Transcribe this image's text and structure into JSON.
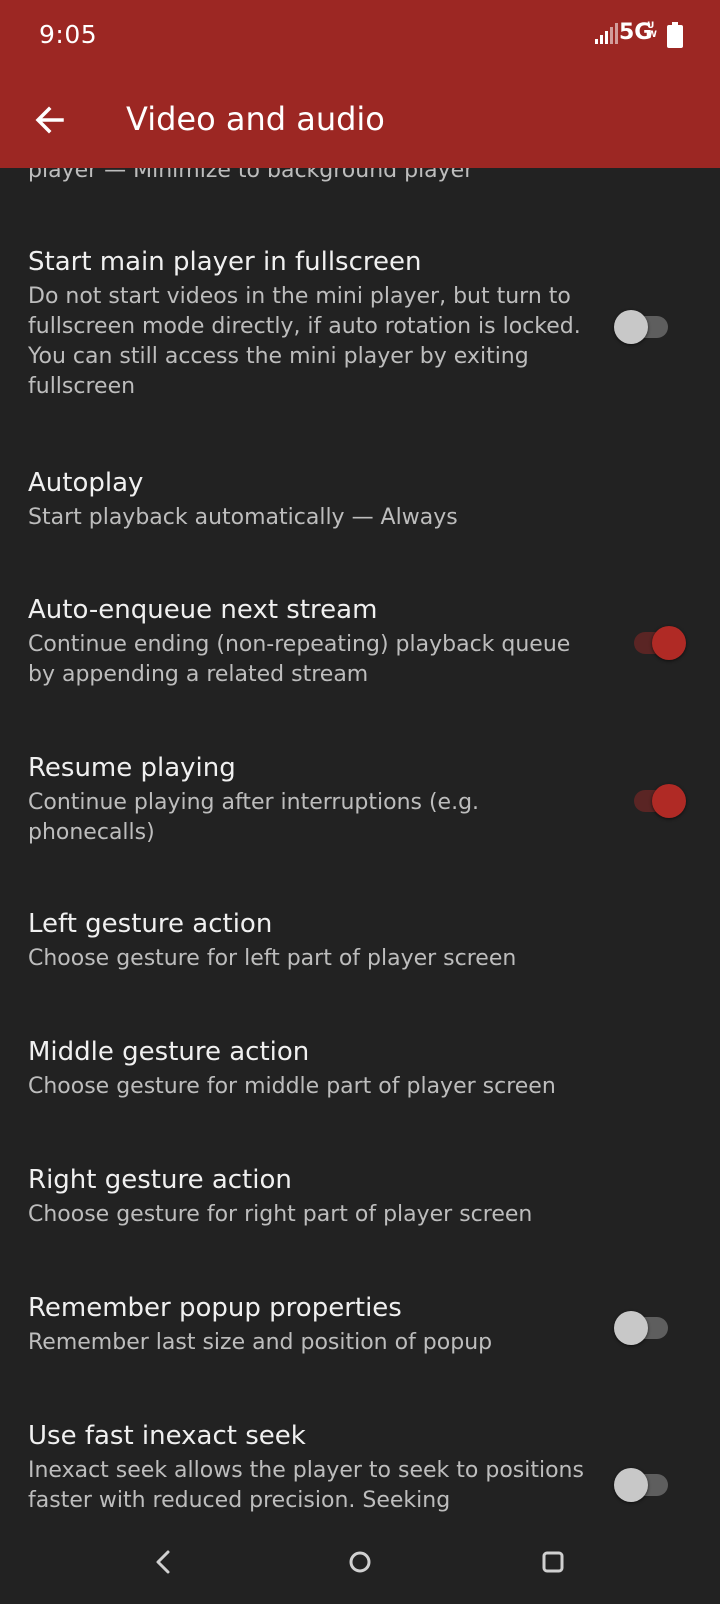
{
  "status_bar": {
    "time": "9:05",
    "network": "5G",
    "network_sub_top": "U",
    "network_sub_bottom": "W",
    "icons": [
      "signal-icon",
      "battery-icon"
    ]
  },
  "app_bar": {
    "title": "Video and audio",
    "back_icon": "arrow-left-icon"
  },
  "partial_summary": "player — Minimize to background player",
  "preferences": [
    {
      "title": "Start main player in fullscreen",
      "summary": "Do not start videos in the mini player, but turn to fullscreen mode directly, if auto rotation is locked. You can still access the mini player by exiting fullscreen",
      "switch": "off"
    },
    {
      "title": "Autoplay",
      "summary": "Start playback automatically — Always",
      "switch": "none"
    },
    {
      "title": "Auto-enqueue next stream",
      "summary": "Continue ending (non-repeating) playback queue by appending a related stream",
      "switch": "on"
    },
    {
      "title": "Resume playing",
      "summary": "Continue playing after interruptions (e.g. phonecalls)",
      "switch": "on"
    },
    {
      "title": "Left gesture action",
      "summary": "Choose gesture for left part of player screen",
      "switch": "none"
    },
    {
      "title": "Middle gesture action",
      "summary": "Choose gesture for middle part of player screen",
      "switch": "none"
    },
    {
      "title": "Right gesture action",
      "summary": "Choose gesture for right part of player screen",
      "switch": "none"
    },
    {
      "title": "Remember popup properties",
      "summary": "Remember last size and position of popup",
      "switch": "off"
    },
    {
      "title": "Use fast inexact seek",
      "summary": "Inexact seek allows the player to seek to positions faster with reduced precision. Seeking",
      "switch": "off"
    }
  ],
  "nav_bar": {
    "icons": [
      "nav-back-icon",
      "nav-home-icon",
      "nav-recents-icon"
    ]
  },
  "colors": {
    "accent": "#9c2723",
    "background": "#222222",
    "switch_on": "#b02a25"
  }
}
